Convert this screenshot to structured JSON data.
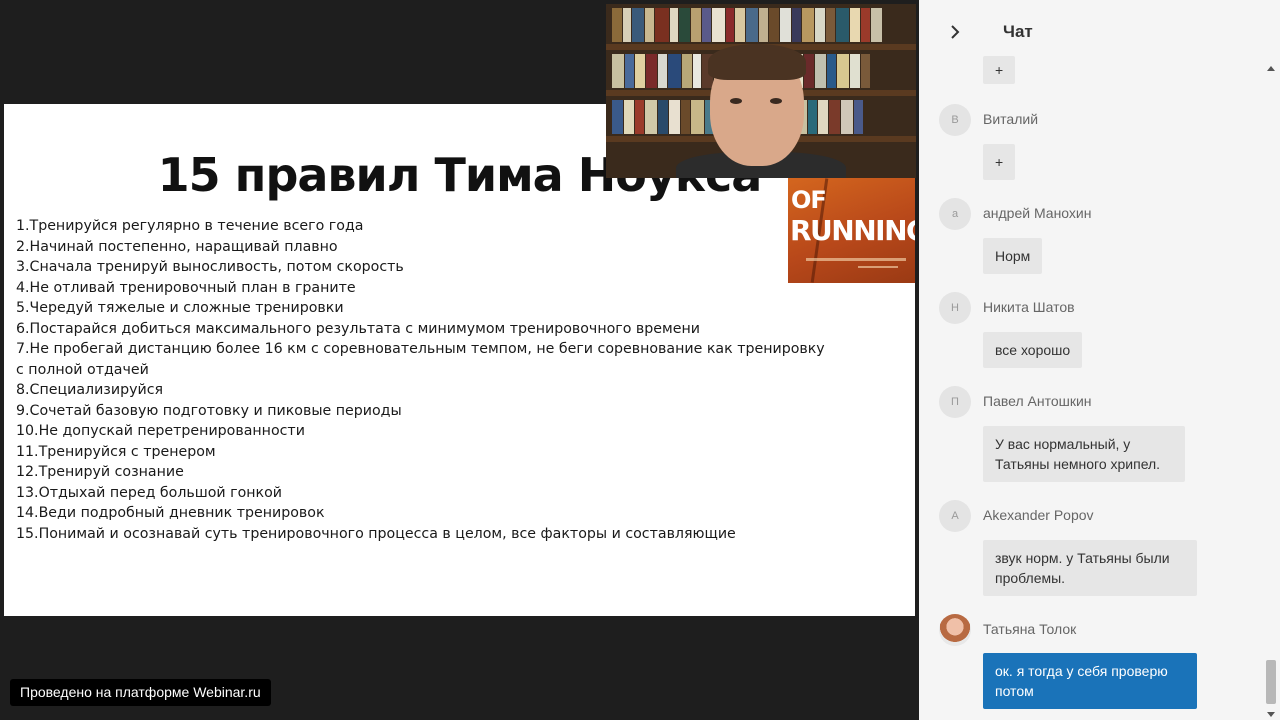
{
  "slide": {
    "title": "15 правил Тима Ноукса",
    "rules": [
      "1.Тренируйся регулярно в течение всего года",
      "2.Начинай постепенно, наращивай плавно",
      "3.Сначала тренируй выносливость, потом скорость",
      "4.Не отливай тренировочный план в граните",
      "5.Чередуй тяжелые и сложные тренировки",
      "6.Постарайся добиться максимального результата с минимумом тренировочного времени",
      "7.Не пробегай дистанцию более 16 км с соревновательным темпом, не беги соревнование как тренировку с полной отдачей",
      "8.Специализируйся",
      "9.Сочетай базовую подготовку и пиковые периоды",
      "10.Не допускай перетренированности",
      "11.Тренируйся с тренером",
      "12.Тренируй сознание",
      "13.Отдыхай перед большой гонкой",
      "14.Веди подробный дневник тренировок",
      "15.Понимай и осознавай суть тренировочного процесса в целом, все факторы и составляющие"
    ],
    "book_cover": {
      "line1": "OF",
      "line2": "RUNNING"
    }
  },
  "footer": {
    "platform_badge": "Проведено на платформе Webinar.ru"
  },
  "chat": {
    "title": "Чат",
    "messages": [
      {
        "avatar": "",
        "author": "",
        "text": "+"
      },
      {
        "avatar": "В",
        "author": "Виталий",
        "text": "+"
      },
      {
        "avatar": "а",
        "author": "андрей Манохин",
        "text": "Норм"
      },
      {
        "avatar": "Н",
        "author": "Никита Шатов",
        "text": "все хорошо"
      },
      {
        "avatar": "П",
        "author": "Павел Антошкин",
        "text": "У вас нормальный, у Татьяны немного хрипел."
      },
      {
        "avatar": "A",
        "author": "Akexander Popov",
        "text": "звук норм. у Татьяны были проблемы."
      },
      {
        "avatar": "",
        "author": "Татьяна Толок",
        "text": "ок. я тогда у себя проверю потом"
      }
    ]
  },
  "colors": {
    "my_bubble": "#1a73b9",
    "bubble": "#e6e6e6",
    "chat_bg": "#f5f5f5",
    "stage_bg": "#1e1e1e"
  }
}
